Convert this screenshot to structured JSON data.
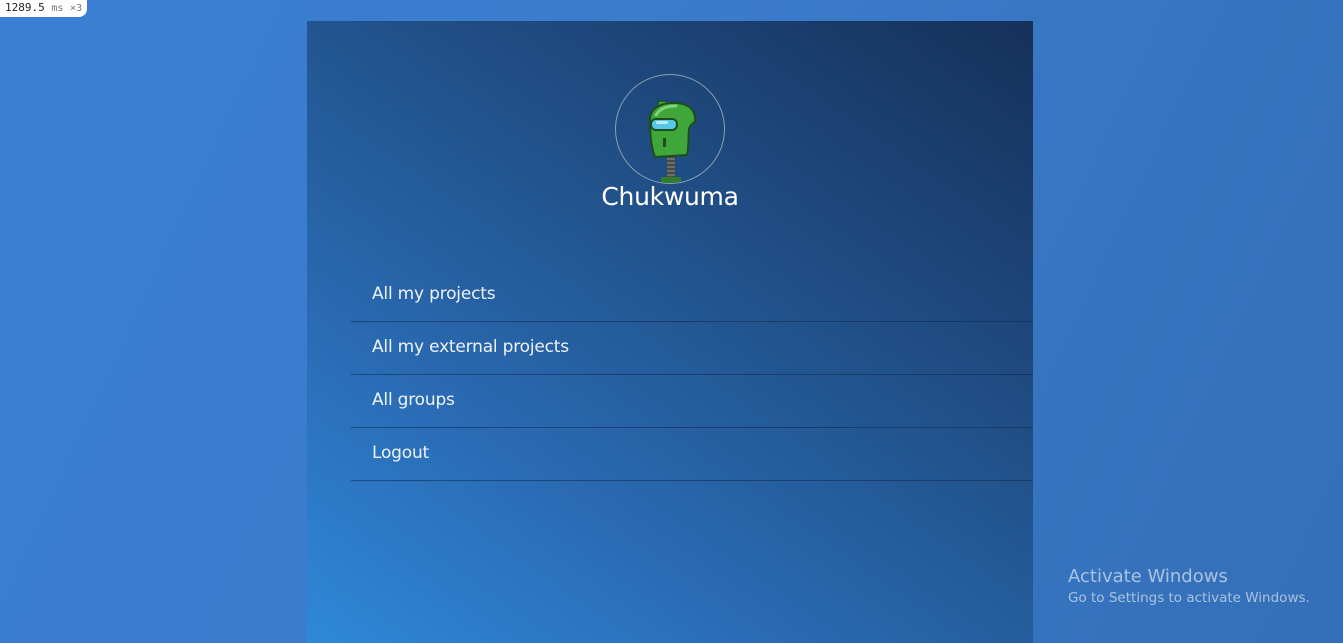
{
  "debug": {
    "time_value": "1289.5",
    "time_unit": "ms",
    "multiplier": "×3"
  },
  "profile": {
    "username": "Chukwuma",
    "avatar_icon": "green-robot-avatar-icon"
  },
  "menu": {
    "items": [
      {
        "label": "All my projects"
      },
      {
        "label": "All my external projects"
      },
      {
        "label": "All groups"
      },
      {
        "label": "Logout"
      }
    ]
  },
  "watermark": {
    "title": "Activate Windows",
    "subtitle": "Go to Settings to activate Windows."
  },
  "colors": {
    "page_background": "#3a7fd2",
    "panel_dark": "#16305a",
    "panel_light": "#2f88d8",
    "text": "#ffffff",
    "avatar_green": "#3fa63a"
  }
}
